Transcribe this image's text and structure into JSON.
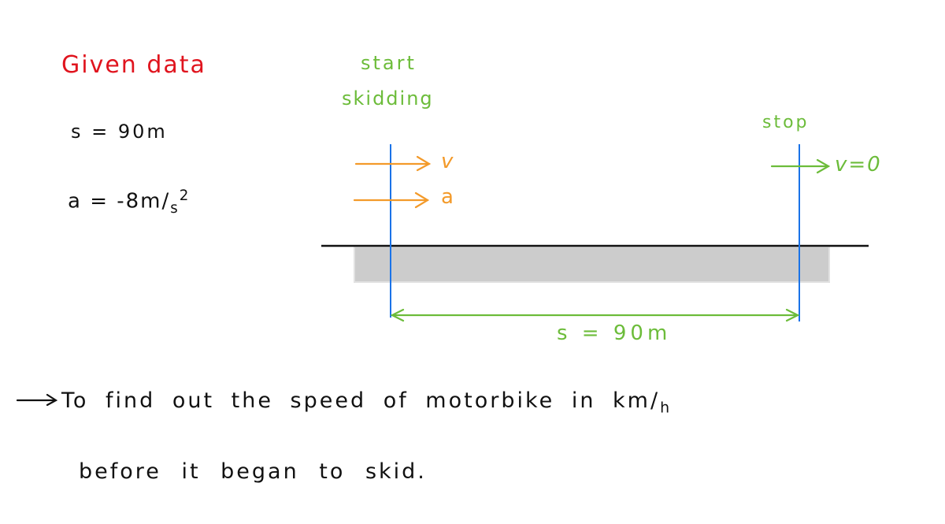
{
  "colors": {
    "heading": "#e0141e",
    "annotation": "#6cbc3a",
    "vector": "#f39a2a",
    "marker": "#1a73e8",
    "ground": "#111111",
    "road": "#cccccc",
    "text": "#111111"
  },
  "given": {
    "heading": "Given data",
    "displacement": "s = 90m",
    "acceleration_prefix": "a = -8m",
    "acceleration_unit_denominator": "s",
    "acceleration_unit_power": "2"
  },
  "diagram": {
    "start_label_line1": "start",
    "start_label_line2": "skidding",
    "stop_label": "stop",
    "velocity_label": "v",
    "acceleration_label": "a",
    "final_velocity_label": "v=0",
    "distance_label": "s = 90m"
  },
  "task": {
    "line1_prefix": "To find out the speed of motorbike in km",
    "line1_unit_denominator": "h",
    "line2": "before it began to skid."
  }
}
